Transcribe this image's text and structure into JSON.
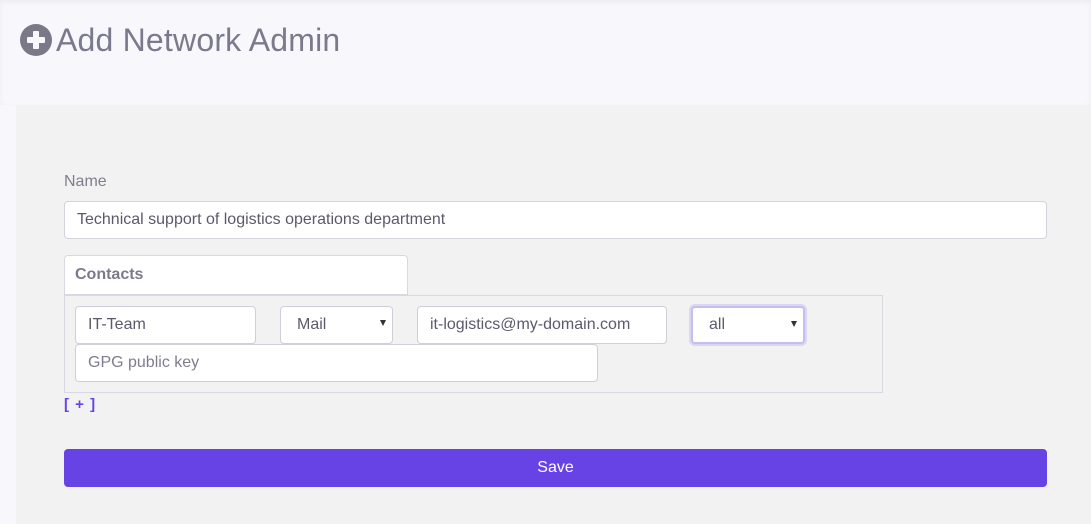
{
  "header": {
    "title": "Add Network Admin",
    "icon": "plus-circle-icon"
  },
  "form": {
    "name_label": "Name",
    "name_value": "Technical support of logistics operations department",
    "contacts_tab_label": "Contacts",
    "contacts": [
      {
        "name": "IT-Team",
        "type": "Mail",
        "address": "it-logistics@my-domain.com",
        "scope": "all",
        "gpg_placeholder": "GPG public key"
      }
    ],
    "add_contact_label": "[ + ]",
    "save_label": "Save"
  },
  "colors": {
    "accent": "#6742e4",
    "panel_bg": "#f2f2f2",
    "page_bg": "#f8f7fc",
    "title_text": "#7b7a8c"
  }
}
